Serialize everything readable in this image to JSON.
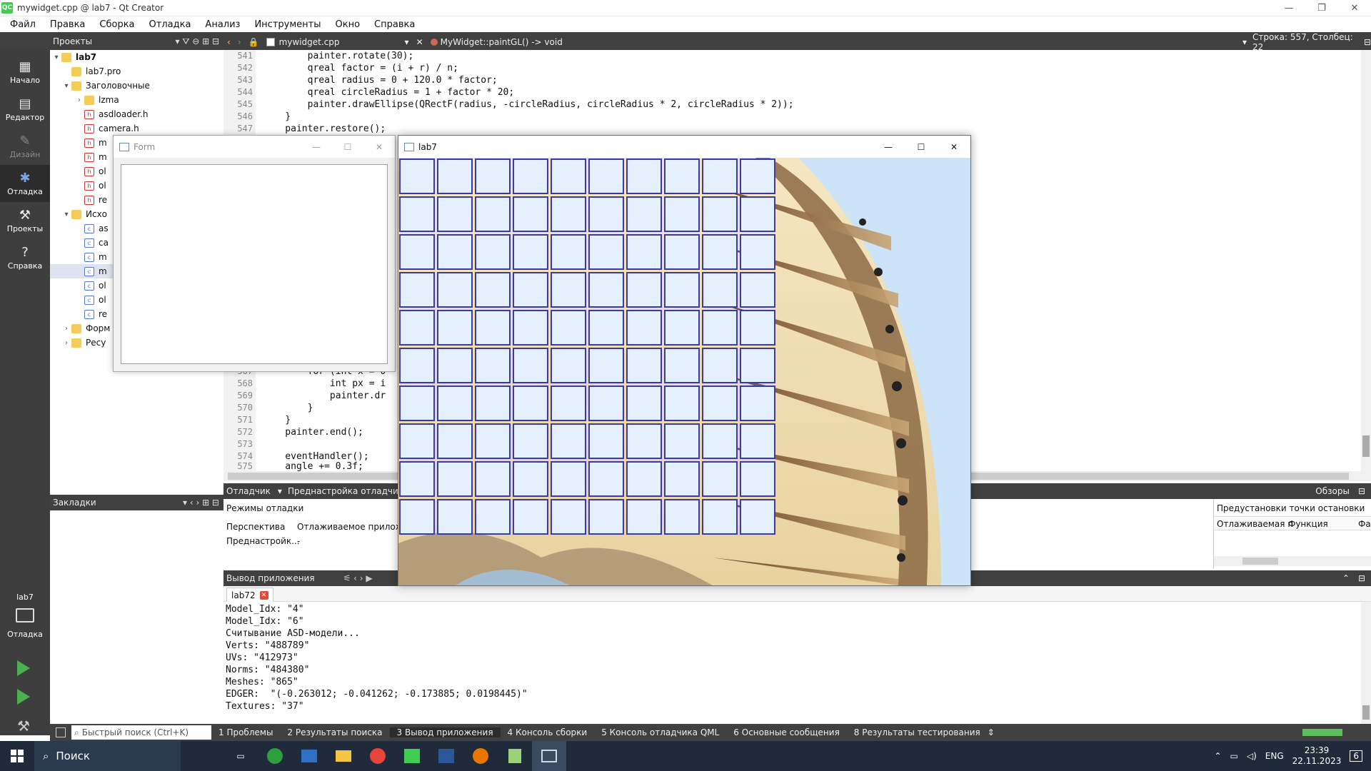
{
  "window": {
    "title": "mywidget.cpp @ lab7 - Qt Creator",
    "app_icon_text": "QC",
    "minimize": "—",
    "restore": "❐",
    "close": "✕"
  },
  "menu": [
    "Файл",
    "Правка",
    "Сборка",
    "Отладка",
    "Анализ",
    "Инструменты",
    "Окно",
    "Справка"
  ],
  "modes": [
    {
      "label": "Начало",
      "icon": "grid-icon"
    },
    {
      "label": "Редактор",
      "icon": "document-icon"
    },
    {
      "label": "Дизайн",
      "icon": "pen-icon"
    },
    {
      "label": "Отладка",
      "icon": "bug-icon"
    },
    {
      "label": "Проекты",
      "icon": "wrench-icon"
    },
    {
      "label": "Справка",
      "icon": "help-icon"
    }
  ],
  "kit": {
    "name": "lab7",
    "mode": "Отладка"
  },
  "projects_panel": {
    "title": "Проекты",
    "tree": [
      {
        "label": "lab7",
        "depth": 0,
        "type": "folder",
        "expanded": true
      },
      {
        "label": "lab7.pro",
        "depth": 1,
        "type": "pro"
      },
      {
        "label": "Заголовочные",
        "depth": 1,
        "type": "folder",
        "expanded": true
      },
      {
        "label": "lzma",
        "depth": 2,
        "type": "folder",
        "expanded": false
      },
      {
        "label": "asdloader.h",
        "depth": 2,
        "type": "h"
      },
      {
        "label": "camera.h",
        "depth": 2,
        "type": "h"
      },
      {
        "label": "m",
        "depth": 2,
        "type": "h"
      },
      {
        "label": "m",
        "depth": 2,
        "type": "h"
      },
      {
        "label": "ol",
        "depth": 2,
        "type": "h"
      },
      {
        "label": "ol",
        "depth": 2,
        "type": "h"
      },
      {
        "label": "re",
        "depth": 2,
        "type": "h"
      },
      {
        "label": "Исхо",
        "depth": 1,
        "type": "folder",
        "expanded": true
      },
      {
        "label": "as",
        "depth": 2,
        "type": "cpp"
      },
      {
        "label": "ca",
        "depth": 2,
        "type": "cpp"
      },
      {
        "label": "m",
        "depth": 2,
        "type": "cpp"
      },
      {
        "label": "m",
        "depth": 2,
        "type": "cpp"
      },
      {
        "label": "ol",
        "depth": 2,
        "type": "cpp"
      },
      {
        "label": "ol",
        "depth": 2,
        "type": "cpp"
      },
      {
        "label": "re",
        "depth": 2,
        "type": "cpp"
      },
      {
        "label": "Форм",
        "depth": 1,
        "type": "folder",
        "expanded": false
      },
      {
        "label": "Ресу",
        "depth": 1,
        "type": "folder",
        "expanded": false
      }
    ]
  },
  "bookmarks_panel": {
    "title": "Закладки"
  },
  "editor": {
    "file": "mywidget.cpp",
    "function": "MyWidget::paintGL() -> void",
    "position": "Строка: 557, Столбец: 22",
    "lines": [
      {
        "n": "541",
        "text": "        painter.rotate(30);"
      },
      {
        "n": "542",
        "text": "        qreal factor = (i + r) / n;"
      },
      {
        "n": "543",
        "text": "        qreal radius = 0 + 120.0 * factor;"
      },
      {
        "n": "544",
        "text": "        qreal circleRadius = 1 + factor * 20;"
      },
      {
        "n": "545",
        "text": "        painter.drawEllipse(QRectF(radius, -circleRadius, circleRadius * 2, circleRadius * 2));"
      },
      {
        "n": "546",
        "text": "    }"
      },
      {
        "n": "547",
        "text": "    painter.restore();"
      },
      {
        "n": "567",
        "text": "        for (int x = 0"
      },
      {
        "n": "568",
        "text": "            int px = i"
      },
      {
        "n": "569",
        "text": "            painter.dr"
      },
      {
        "n": "570",
        "text": "        }"
      },
      {
        "n": "571",
        "text": "    }"
      },
      {
        "n": "572",
        "text": "    painter.end();"
      },
      {
        "n": "573",
        "text": ""
      },
      {
        "n": "574",
        "text": "    eventHandler();"
      },
      {
        "n": "575",
        "text": "    angle += 0.3f;"
      }
    ]
  },
  "debugger": {
    "tab": "Отладчик",
    "preset_tab": "Преднастройка отладчика",
    "reviews": "Обзоры",
    "modes_title": "Режимы отладки",
    "perspective_label": "Перспектива",
    "perspective_value": "Отлаживаемое приложен",
    "preset_label": "Преднастройк...",
    "preset_value": "-",
    "breakpoints_title": "Предустановки точки остановки",
    "bp_col1": "Отлаживаемая п",
    "bp_col2": "Функция",
    "bp_col3": "Фа"
  },
  "app_output": {
    "title": "Вывод приложения",
    "tab": "lab72",
    "lines": [
      "Model_Idx: \"4\"",
      "Model_Idx: \"6\"",
      "Считывание ASD-модели...",
      "Verts: \"488789\"",
      "UVs: \"412973\"",
      "Norms: \"484380\"",
      "Meshes: \"865\"",
      "EDGER:  \"(-0.263012; -0.041262; -0.173885; 0.0198445)\"",
      "Textures: \"37\""
    ]
  },
  "status_bar": {
    "search_placeholder": "Быстрый поиск (Ctrl+K)",
    "panes": [
      "1  Проблемы",
      "2  Результаты поиска",
      "3  Вывод приложения",
      "4  Консоль сборки",
      "5  Консоль отладчика QML",
      "6  Основные сообщения",
      "8  Результаты тестирования"
    ]
  },
  "form_window": {
    "title": "Form"
  },
  "lab7_window": {
    "title": "lab7"
  },
  "taskbar": {
    "search": "Поиск",
    "lang": "ENG",
    "time": "23:39",
    "date": "22.11.2023",
    "notifications": "6"
  }
}
